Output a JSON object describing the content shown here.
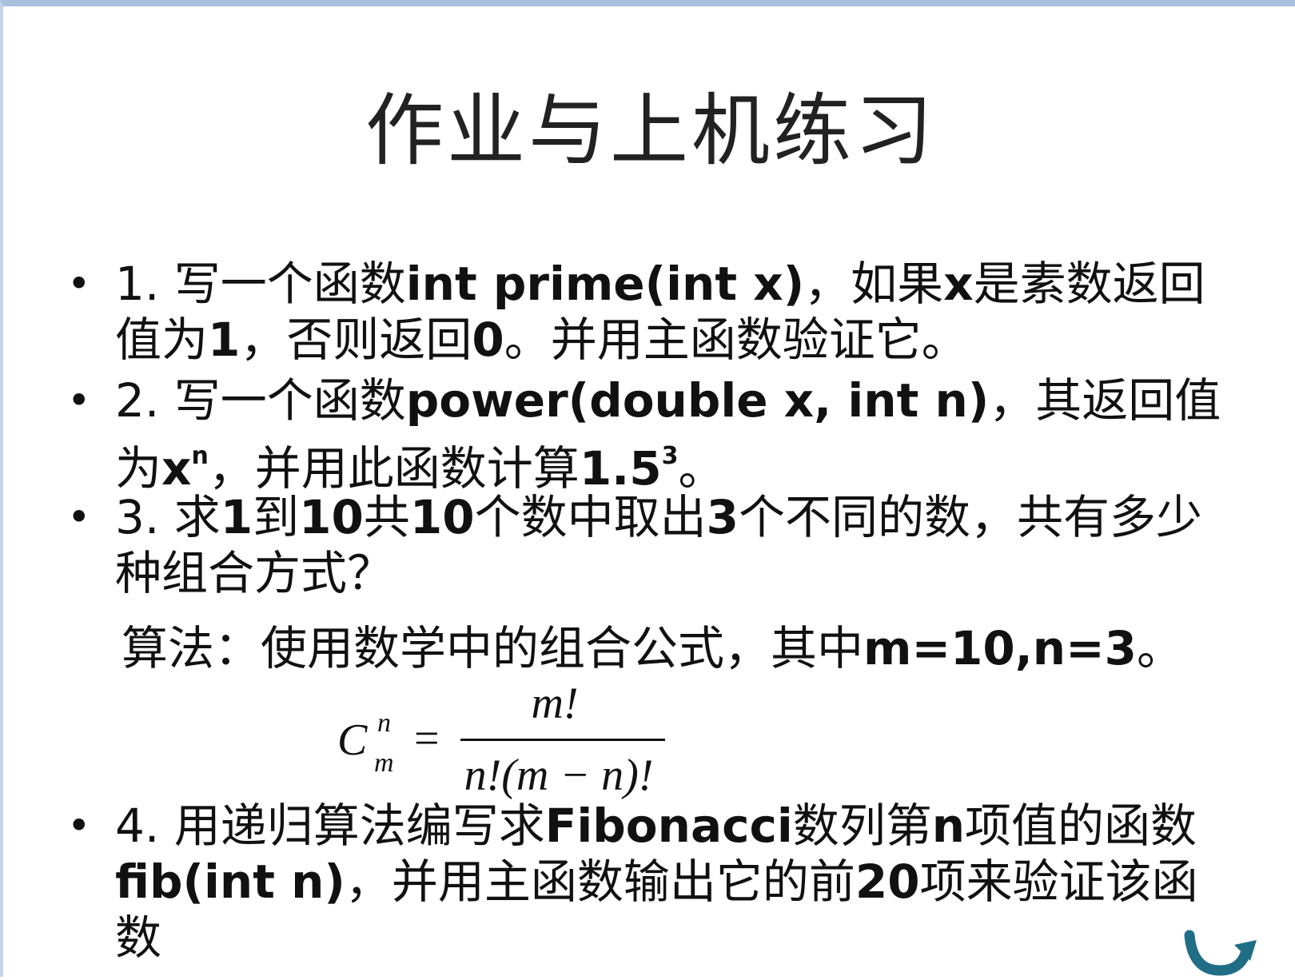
{
  "slide": {
    "title": "作业与上机练习",
    "bullet_glyph": "•",
    "items": [
      {
        "p1": "1.  写一个函数",
        "b1": "int prime(int x)",
        "p2": "，如果",
        "b2": "x",
        "p3": "是素数返回值为",
        "b3": "1",
        "p4": "，否则返回",
        "b4": "0",
        "p5": "。并用主函数验证它。"
      },
      {
        "p1": "2.  写一个函数",
        "b1": "power(double x, int n)",
        "p2": "，其返回值为",
        "b2": "x",
        "sup1": "n",
        "p3": "，并用此函数计算",
        "b3": "1.5",
        "sup2": "3",
        "p4": "。"
      },
      {
        "p1": "3.  求",
        "b1": "1",
        "p2": "到",
        "b2": "10",
        "p3": "共",
        "b3": "10",
        "p4": "个数中取出",
        "b4": "3",
        "p5": "个不同的数，共有多少种组合方式？"
      },
      {
        "p1": "4.  用递归算法编写求",
        "b1": "Fibonacci",
        "p2": "数列第",
        "b2": "n",
        "p3": "项值的函数",
        "b3": "fib(int n)",
        "p4": "，并用主函数输出它的前",
        "b4": "20",
        "p5": "项来验证该函数"
      }
    ],
    "algorithm": {
      "p1": "算法：使用数学中的组合公式，其中",
      "b1": "m=10,n=3",
      "p2": "。"
    },
    "formula": {
      "C": "C",
      "sup": "n",
      "sub": "m",
      "eq": "=",
      "numerator": "m!",
      "denominator": "n!(m − n)!"
    },
    "nav_icon": "return-arrow-icon"
  }
}
